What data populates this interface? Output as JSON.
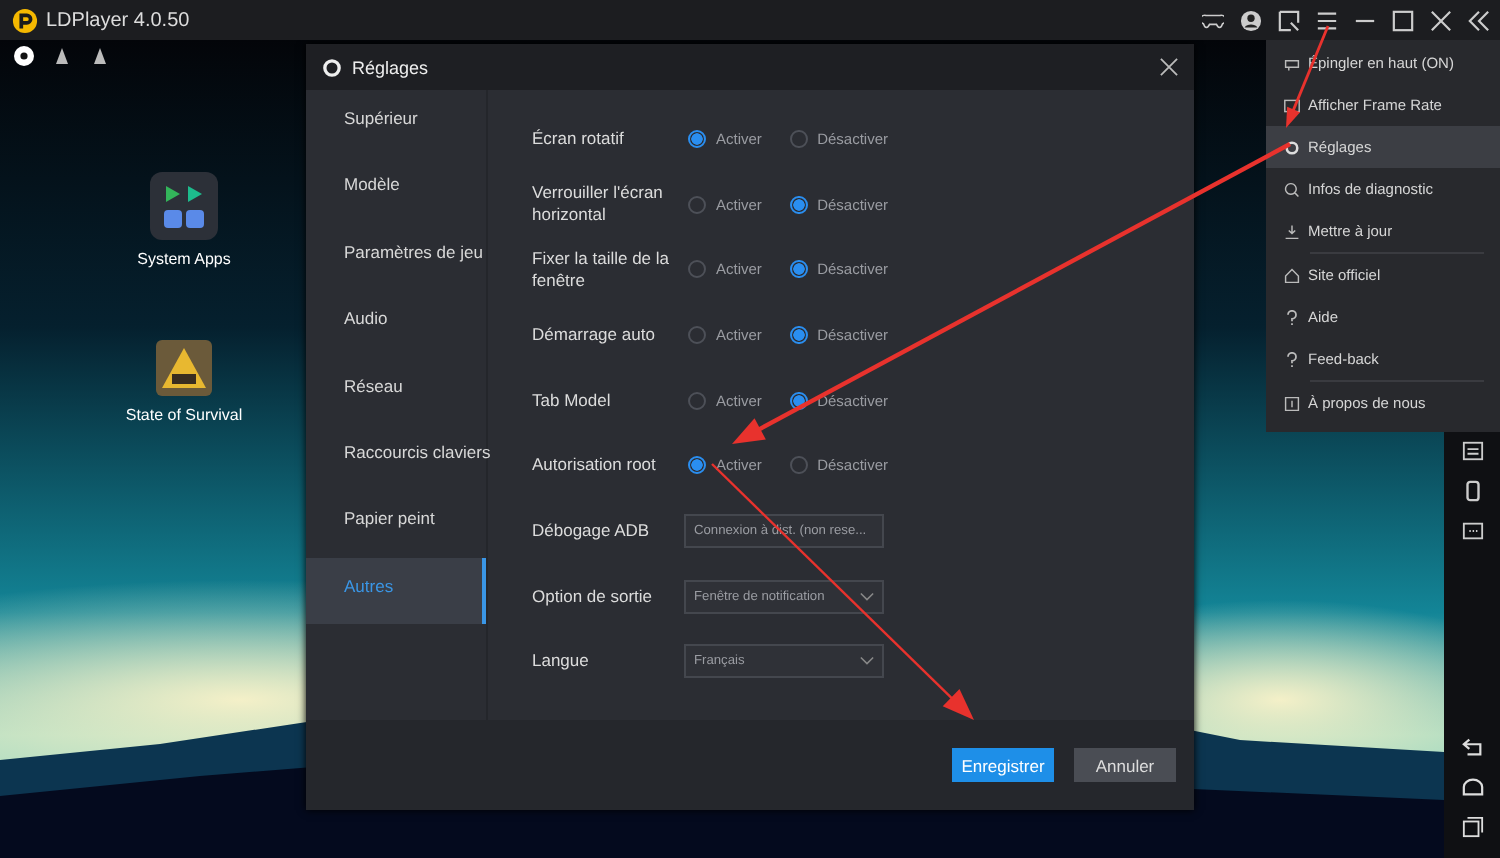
{
  "app": {
    "title": "LDPlayer 4.0.50"
  },
  "desktop_icons": [
    {
      "label": "System Apps"
    },
    {
      "label": "State of Survival"
    }
  ],
  "dialog": {
    "title": "Réglages",
    "nav": [
      {
        "label": "Supérieur",
        "selected": false
      },
      {
        "label": "Modèle",
        "selected": false
      },
      {
        "label": "Paramètres de jeu",
        "selected": false
      },
      {
        "label": "Audio",
        "selected": false
      },
      {
        "label": "Réseau",
        "selected": false
      },
      {
        "label": "Raccourcis claviers",
        "selected": false
      },
      {
        "label": "Papier peint",
        "selected": false
      },
      {
        "label": "Autres",
        "selected": true
      }
    ],
    "rows": [
      {
        "kind": "radio",
        "label": "Écran rotatif",
        "options": [
          {
            "label": "Activer",
            "selected": true
          },
          {
            "label": "Désactiver",
            "selected": false
          }
        ]
      },
      {
        "kind": "radio",
        "label": "Verrouiller l'écran horizontal",
        "options": [
          {
            "label": "Activer",
            "selected": false
          },
          {
            "label": "Désactiver",
            "selected": true
          }
        ]
      },
      {
        "kind": "radio",
        "label": "Fixer la taille de la fenêtre",
        "options": [
          {
            "label": "Activer",
            "selected": false
          },
          {
            "label": "Désactiver",
            "selected": true
          }
        ]
      },
      {
        "kind": "radio",
        "label": "Démarrage auto",
        "options": [
          {
            "label": "Activer",
            "selected": false
          },
          {
            "label": "Désactiver",
            "selected": true
          }
        ]
      },
      {
        "kind": "radio",
        "label": "Tab Model",
        "options": [
          {
            "label": "Activer",
            "selected": false
          },
          {
            "label": "Désactiver",
            "selected": true
          }
        ]
      },
      {
        "kind": "radio",
        "label": "Autorisation root",
        "options": [
          {
            "label": "Activer",
            "selected": true
          },
          {
            "label": "Désactiver",
            "selected": false
          }
        ]
      },
      {
        "kind": "field",
        "label": "Débogage ADB",
        "value": "Connexion à dist. (non rese..."
      },
      {
        "kind": "select",
        "label": "Option de sortie",
        "value": "Fenêtre de notification"
      },
      {
        "kind": "select",
        "label": "Langue",
        "value": "Français"
      }
    ],
    "buttons": [
      {
        "label": "Enregistrer",
        "primary": true
      },
      {
        "label": "Annuler",
        "primary": false
      }
    ]
  },
  "menu": {
    "items": [
      {
        "label": "Épingler en haut (ON)",
        "selected": false,
        "divider_before": false
      },
      {
        "label": "Afficher Frame Rate",
        "selected": false,
        "divider_before": false
      },
      {
        "label": "Réglages",
        "selected": true,
        "divider_before": false
      },
      {
        "label": "Infos de diagnostic",
        "selected": false,
        "divider_before": false
      },
      {
        "label": "Mettre à jour",
        "selected": false,
        "divider_before": false
      },
      {
        "label": "Site officiel",
        "selected": false,
        "divider_before": true
      },
      {
        "label": "Aide",
        "selected": false,
        "divider_before": false
      },
      {
        "label": "Feed-back",
        "selected": false,
        "divider_before": false
      },
      {
        "label": "À propos de nous",
        "selected": false,
        "divider_before": true
      }
    ]
  }
}
